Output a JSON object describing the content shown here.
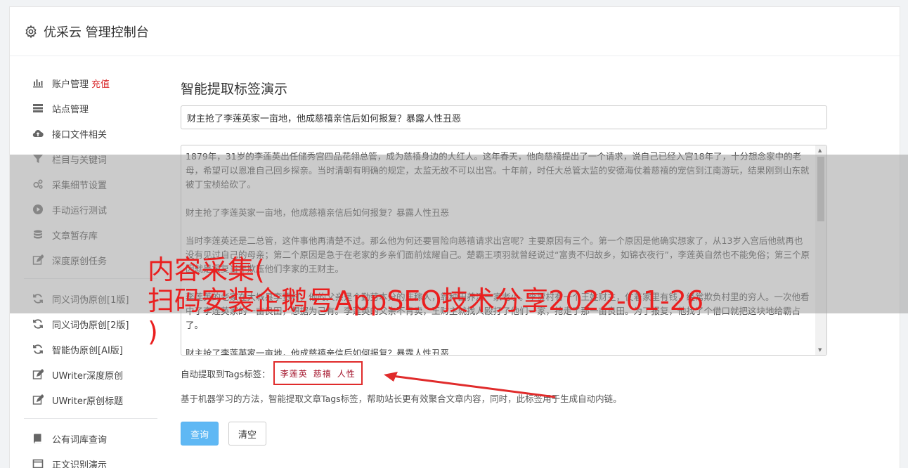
{
  "header": {
    "title": "优采云 管理控制台",
    "icon": "gear-icon"
  },
  "sidebar": {
    "group1": [
      {
        "label": "账户管理",
        "badge": "充值",
        "icon": "bar-chart-icon"
      },
      {
        "label": "站点管理",
        "icon": "server-icon"
      },
      {
        "label": "接口文件相关",
        "icon": "cloud-upload-icon"
      },
      {
        "label": "栏目与关键词",
        "icon": "filter-icon"
      },
      {
        "label": "采集细节设置",
        "icon": "gears-icon"
      },
      {
        "label": "手动运行测试",
        "icon": "play-circle-icon"
      },
      {
        "label": "文章暂存库",
        "icon": "database-icon"
      },
      {
        "label": "深度原创任务",
        "icon": "edit-icon"
      }
    ],
    "group2": [
      {
        "label": "同义词伪原创[1版]",
        "icon": "refresh-icon"
      },
      {
        "label": "同义词伪原创[2版]",
        "icon": "refresh-icon"
      },
      {
        "label": "智能伪原创[AI版]",
        "icon": "refresh-icon"
      },
      {
        "label": "UWriter深度原创",
        "icon": "edit-icon"
      },
      {
        "label": "UWriter原创标题",
        "icon": "edit-icon"
      }
    ],
    "group3": [
      {
        "label": "公有词库查询",
        "icon": "book-icon"
      },
      {
        "label": "正文识别演示",
        "icon": "window-icon"
      }
    ]
  },
  "main": {
    "heading": "智能提取标签演示",
    "title_value": "财主抢了李莲英家一亩地，他成慈禧亲信后如何报复？暴露人性丑恶",
    "content_paragraphs": [
      "1879年，31岁的李莲英出任储秀宫四品花翎总管，成为慈禧身边的大红人。这年春天，他向慈禧提出了一个请求，说自己已经入宫18年了，十分想念家中的老母，希望可以恩准自己回乡探亲。当时清朝有明确的规定，太监无故不可以出宫。十年前，时任大总管太监的安德海仗着慈禧的宠信到江南游玩，结果刚到山东就被丁宝桢给砍了。",
      "财主抢了李莲英家一亩地，他成慈禧亲信后如何报复？暴露人性丑恶",
      "当时李莲英还是二总管，这件事他再清楚不过。那么他为何还要冒险向慈禧请求出宫呢？主要原因有三个。第一个原因是他确实想家了，从13岁入宫后他就再也没有见过自己的母亲；第二个原因是急于在老家的乡亲们面前炫耀自己。楚霸王项羽就曾经说过“富贵不归故乡，如锦衣夜行”，李莲英自然也不能免俗；第三个原因就是报复当年欺压他们李家的王财主。",
      "李莲英的老家在大城县李贾村，他的父亲是个勤劳本分的庄稼人，靠种田养活一家老小。李贾村有一个王姓财主，仗着家里有钱，经常欺负村里的穷人。一次他看中了李莲英家的一亩良田，想据为己有。李莲英的父亲不肯卖，王财主就找人殴打了他们一家，抢走了那一亩良田。为了报复，他找了个借口就把这块地给霸占了。",
      "财主抢了李莲英家一亩地，他成慈禧亲信后如何报复？暴露人性丑恶"
    ],
    "tags_label": "自动提取到Tags标签：",
    "tags": [
      "李莲英",
      "慈禧",
      "人性"
    ],
    "description": "基于机器学习的方法，智能提取文章Tags标签，帮助站长更有效聚合文章内容，同时，此标签用于生成自动内链。",
    "query_button": "查询",
    "clear_button": "清空"
  },
  "watermark": {
    "line1": "内容采集(",
    "line2": "扫码安装企鹅号AppSEO技术分享2022-01-26",
    "line3": ")"
  },
  "colors": {
    "accent": "#5fb8f4",
    "badge": "#d9282b",
    "tag": "#a3122a",
    "watermark": "#ea1f1f"
  }
}
